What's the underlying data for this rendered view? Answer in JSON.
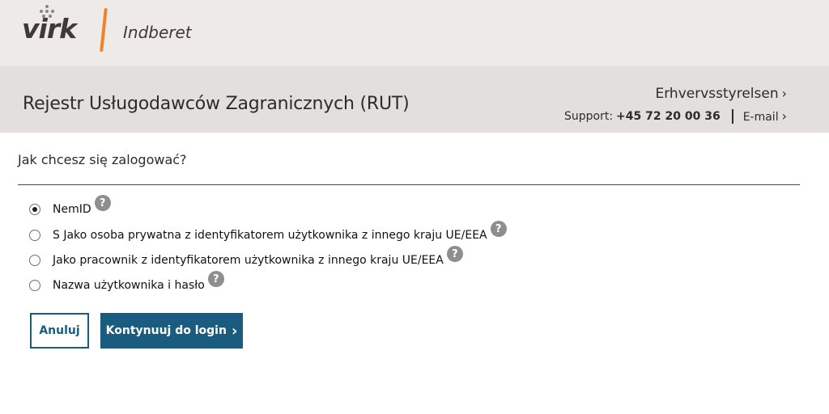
{
  "header": {
    "logo_text": "virk",
    "app_name": "Indberet"
  },
  "subheader": {
    "page_title": "Rejestr Usługodawców Zagranicznych (RUT)",
    "agency": "Erhvervsstyrelsen",
    "support_label": "Support:",
    "support_phone": "+45 72 20 00 36",
    "email_label": "E-mail",
    "chevron": "›"
  },
  "login": {
    "question": "Jak chcesz się zalogować?",
    "help_glyph": "?",
    "options": [
      {
        "label": "NemID",
        "selected": true
      },
      {
        "label": "S Jako osoba prywatna z identyfikatorem użytkownika z innego kraju UE/EEA",
        "selected": false
      },
      {
        "label": "Jako pracownik z identyfikatorem użytkownika z innego kraju UE/EEA",
        "selected": false
      },
      {
        "label": "Nazwa użytkownika i hasło",
        "selected": false
      }
    ]
  },
  "actions": {
    "cancel_label": "Anuluj",
    "continue_label": "Kontynuuj do login",
    "continue_chevron": "›"
  },
  "colors": {
    "accent": "#1a5c7f",
    "logo_divider": "#f0822a",
    "header_bg": "#eeeae8",
    "subheader_bg": "#e2dfdd",
    "help_bg": "#8e8e8e"
  }
}
